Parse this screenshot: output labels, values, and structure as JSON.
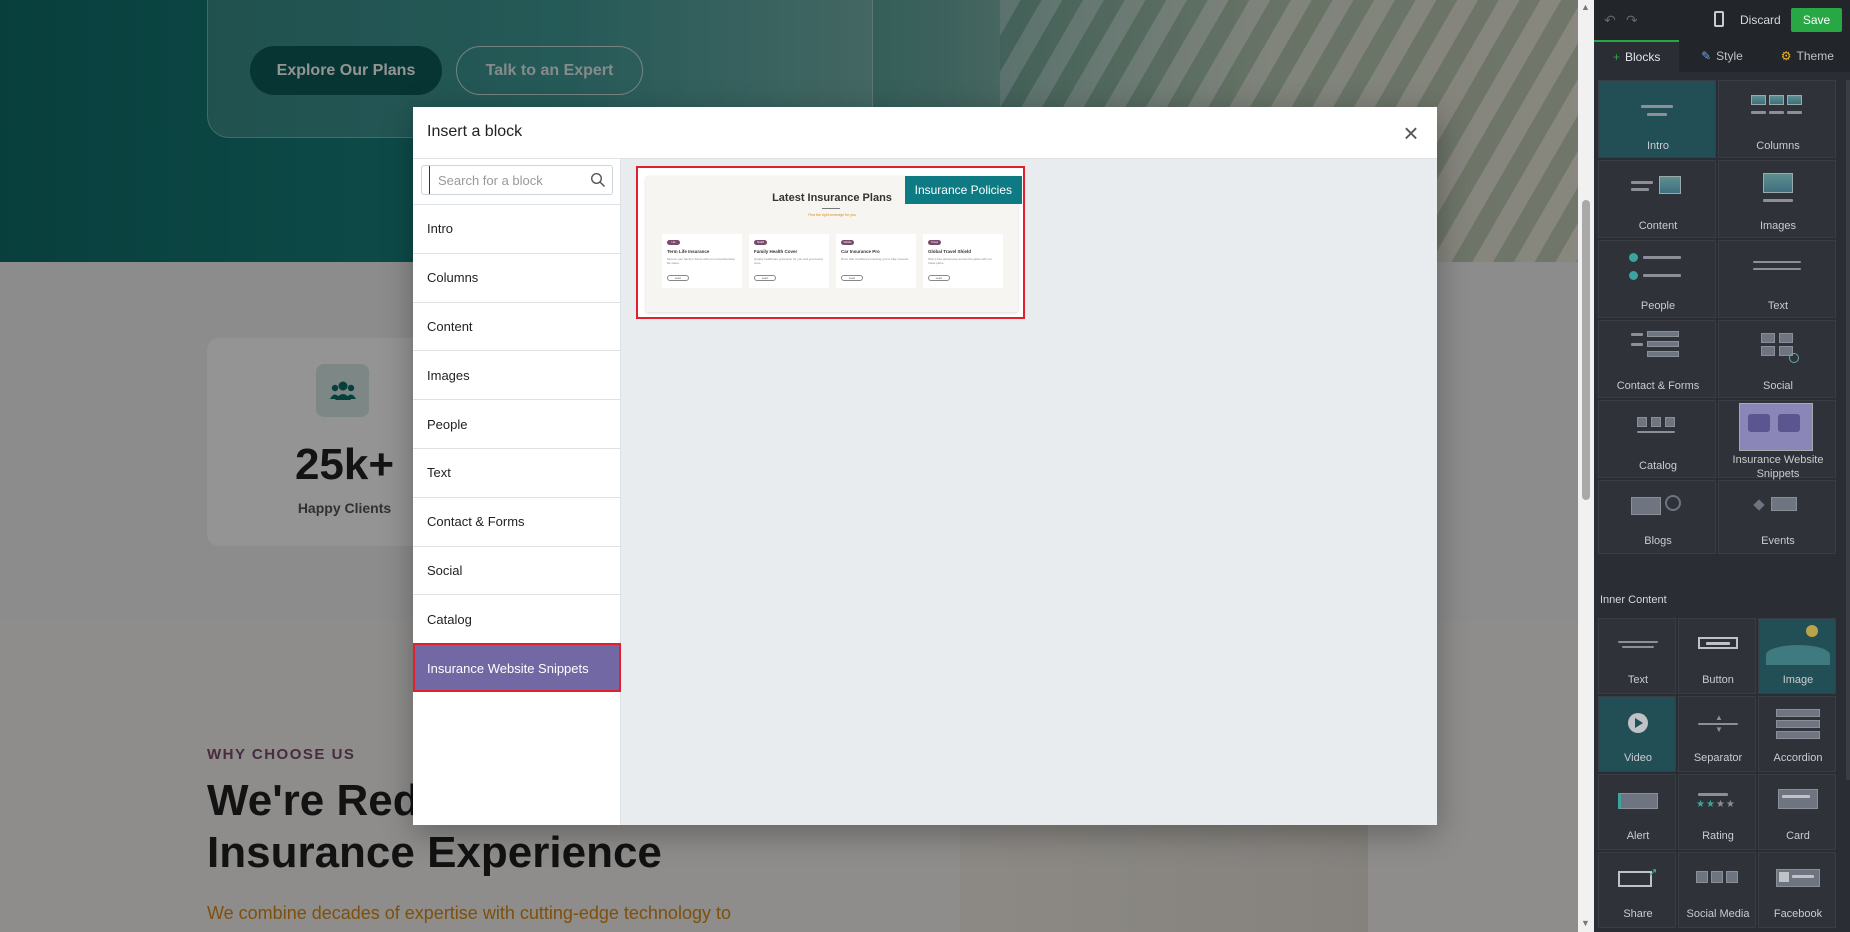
{
  "site": {
    "hero": {
      "explore_label": "Explore Our Plans",
      "expert_label": "Talk to an Expert"
    },
    "stats": {
      "value": "25k+",
      "label": "Happy Clients"
    },
    "why": {
      "kicker": "WHY CHOOSE US",
      "title_line1": "We're Rede",
      "title_line2": "Insurance Experience",
      "desc": "We combine decades of expertise with cutting-edge technology to"
    }
  },
  "modal": {
    "title": "Insert a block",
    "close_label": "×",
    "search": {
      "placeholder": "Search for a block",
      "value": ""
    },
    "categories": [
      {
        "label": "Intro"
      },
      {
        "label": "Columns"
      },
      {
        "label": "Content"
      },
      {
        "label": "Images"
      },
      {
        "label": "People"
      },
      {
        "label": "Text"
      },
      {
        "label": "Contact & Forms"
      },
      {
        "label": "Social"
      },
      {
        "label": "Catalog"
      },
      {
        "label": "Insurance Website Snippets",
        "active": true
      }
    ],
    "snippet": {
      "badge": "Insurance Policies",
      "preview_title": "Latest Insurance Plans",
      "preview_subtitle": "Find the right coverage for you",
      "cards": [
        {
          "tag": "Life",
          "name": "Term Life Insurance",
          "desc": "Secure your family's future with our comprehensive life plans.",
          "btn": "Learn"
        },
        {
          "tag": "Health",
          "name": "Family Health Cover",
          "desc": "Quality healthcare protection for you and your loved ones.",
          "btn": "Learn"
        },
        {
          "tag": "Vehicle",
          "name": "Car Insurance Pro",
          "desc": "Drive with confidence knowing you're fully covered.",
          "btn": "Learn"
        },
        {
          "tag": "Travel",
          "name": "Global Travel Shield",
          "desc": "Worry-free adventures across the globe with our travel plans.",
          "btn": "Learn"
        }
      ]
    }
  },
  "editor": {
    "undo_label": "↶",
    "redo_label": "↷",
    "discard_label": "Discard",
    "save_label": "Save",
    "tabs": [
      {
        "label": "Blocks",
        "icon": "+",
        "active": true
      },
      {
        "label": "Style",
        "icon": "✎"
      },
      {
        "label": "Theme",
        "icon": "⚙"
      }
    ],
    "blocks": [
      {
        "label": "Intro"
      },
      {
        "label": "Columns"
      },
      {
        "label": "Content"
      },
      {
        "label": "Images"
      },
      {
        "label": "People"
      },
      {
        "label": "Text"
      },
      {
        "label": "Contact & Forms"
      },
      {
        "label": "Social"
      },
      {
        "label": "Catalog"
      },
      {
        "label": "Insurance Website Snippets"
      },
      {
        "label": "Blogs"
      },
      {
        "label": "Events"
      }
    ],
    "inner_title": "Inner Content",
    "inner": [
      {
        "label": "Text"
      },
      {
        "label": "Button"
      },
      {
        "label": "Image"
      },
      {
        "label": "Video"
      },
      {
        "label": "Separator"
      },
      {
        "label": "Accordion"
      },
      {
        "label": "Alert"
      },
      {
        "label": "Rating"
      },
      {
        "label": "Card"
      },
      {
        "label": "Share"
      },
      {
        "label": "Social Media"
      },
      {
        "label": "Facebook"
      }
    ]
  },
  "colors": {
    "accent_green": "#28a745",
    "active_category": "#7168a4",
    "highlight_red": "#e0212d",
    "badge_teal": "#0d7a84"
  }
}
